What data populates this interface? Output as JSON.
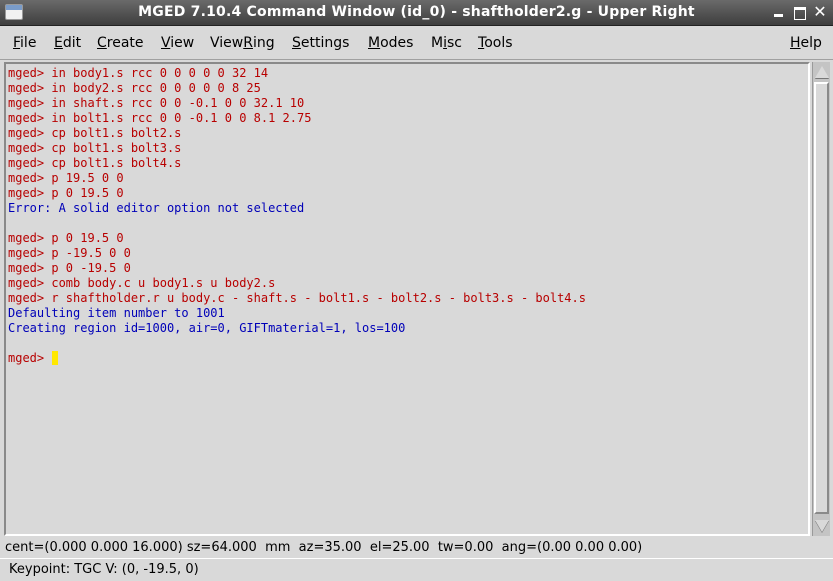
{
  "window": {
    "title": "MGED 7.10.4 Command Window (id_0) - shaftholder2.g - Upper Right",
    "close_glyph": "✕"
  },
  "menu": {
    "items": [
      {
        "first": "F",
        "rest": "ile"
      },
      {
        "first": "E",
        "rest": "dit"
      },
      {
        "first": "C",
        "rest": "reate"
      },
      {
        "first": "V",
        "rest": "iew"
      },
      {
        "pre": "View",
        "first": "R",
        "rest": "ing"
      },
      {
        "first": "S",
        "rest": "ettings"
      },
      {
        "first": "M",
        "rest": "odes"
      },
      {
        "pre": "M",
        "first": "i",
        "rest": "sc"
      },
      {
        "first": "T",
        "rest": "ools"
      },
      {
        "first": "H",
        "rest": "elp"
      }
    ]
  },
  "console": {
    "prompt": "mged>",
    "lines": [
      {
        "type": "cmd",
        "text": "in body1.s rcc 0 0 0 0 0 32 14"
      },
      {
        "type": "cmd",
        "text": "in body2.s rcc 0 0 0 0 0 8 25"
      },
      {
        "type": "cmd",
        "text": "in shaft.s rcc 0 0 -0.1 0 0 32.1 10"
      },
      {
        "type": "cmd",
        "text": "in bolt1.s rcc 0 0 -0.1 0 0 8.1 2.75"
      },
      {
        "type": "cmd",
        "text": "cp bolt1.s bolt2.s"
      },
      {
        "type": "cmd",
        "text": "cp bolt1.s bolt3.s"
      },
      {
        "type": "cmd",
        "text": "cp bolt1.s bolt4.s"
      },
      {
        "type": "cmd",
        "text": "p 19.5 0 0"
      },
      {
        "type": "cmd",
        "text": "p 0 19.5 0"
      },
      {
        "type": "out",
        "text": "Error: A solid editor option not selected"
      },
      {
        "type": "blank",
        "text": ""
      },
      {
        "type": "cmd",
        "text": "p 0 19.5 0"
      },
      {
        "type": "cmd",
        "text": "p -19.5 0 0"
      },
      {
        "type": "cmd",
        "text": "p 0 -19.5 0"
      },
      {
        "type": "cmd",
        "text": "comb body.c u body1.s u body2.s"
      },
      {
        "type": "cmd",
        "text": "r shaftholder.r u body.c - shaft.s - bolt1.s - bolt2.s - bolt3.s - bolt4.s"
      },
      {
        "type": "out",
        "text": "Defaulting item number to 1001"
      },
      {
        "type": "out",
        "text": "Creating region id=1000, air=0, GIFTmaterial=1, los=100"
      },
      {
        "type": "blank",
        "text": ""
      },
      {
        "type": "input",
        "text": ""
      }
    ]
  },
  "status": {
    "view": "cent=(0.000 0.000 16.000) sz=64.000  mm  az=35.00  el=25.00  tw=0.00  ang=(0.00 0.00 0.00)",
    "keypoint": "Keypoint: TGC V: (0, -19.5, 0)"
  },
  "colors": {
    "prompt": "#b80000",
    "output": "#0000b8",
    "cursor": "#ffe800"
  },
  "icons": [
    "window-menu-icon",
    "minimize-icon",
    "maximize-icon",
    "close-icon",
    "scroll-up-arrow-icon",
    "scroll-down-arrow-icon"
  ]
}
